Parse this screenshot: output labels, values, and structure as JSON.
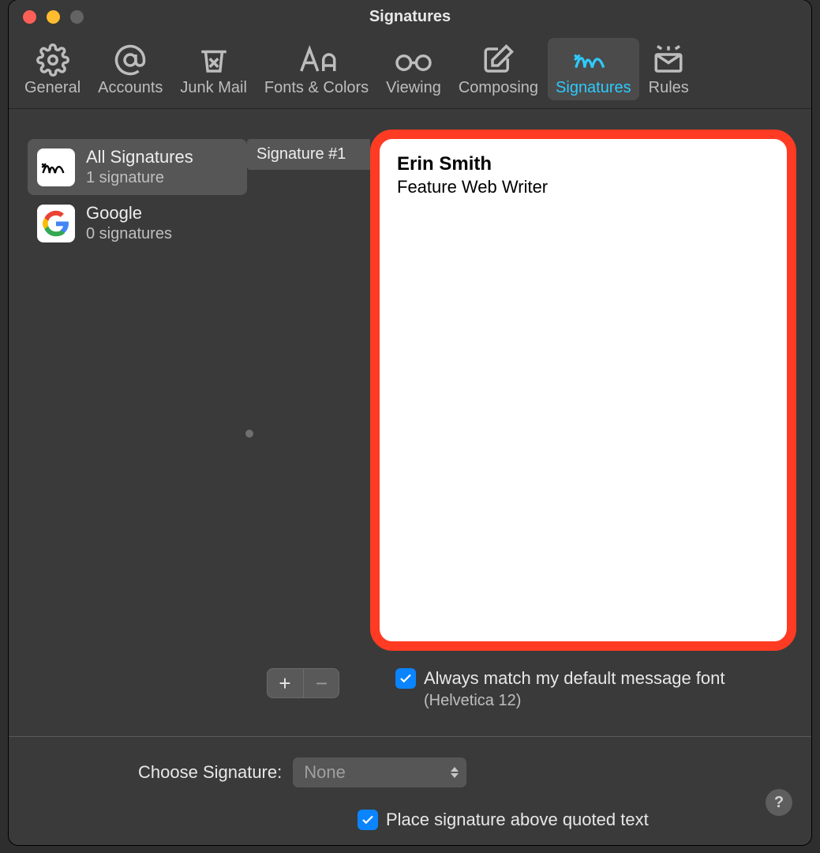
{
  "window": {
    "title": "Signatures"
  },
  "toolbar": {
    "items": [
      {
        "label": "General"
      },
      {
        "label": "Accounts"
      },
      {
        "label": "Junk Mail"
      },
      {
        "label": "Fonts & Colors"
      },
      {
        "label": "Viewing"
      },
      {
        "label": "Composing"
      },
      {
        "label": "Signatures"
      },
      {
        "label": "Rules"
      }
    ],
    "active_index": 6
  },
  "accounts": [
    {
      "name": "All Signatures",
      "count_label": "1 signature",
      "selected": true
    },
    {
      "name": "Google",
      "count_label": "0 signatures",
      "selected": false
    }
  ],
  "signature_list": [
    {
      "label": "Signature #1",
      "selected": true
    }
  ],
  "editor": {
    "name": "Erin Smith",
    "title": "Feature Web Writer"
  },
  "controls": {
    "add": "+",
    "remove": "−"
  },
  "match_default_font": {
    "checked": true,
    "label": "Always match my default message font",
    "sub": "(Helvetica 12)"
  },
  "choose": {
    "label": "Choose Signature:",
    "value": "None"
  },
  "place_above": {
    "checked": true,
    "label": "Place signature above quoted text"
  },
  "help": "?"
}
